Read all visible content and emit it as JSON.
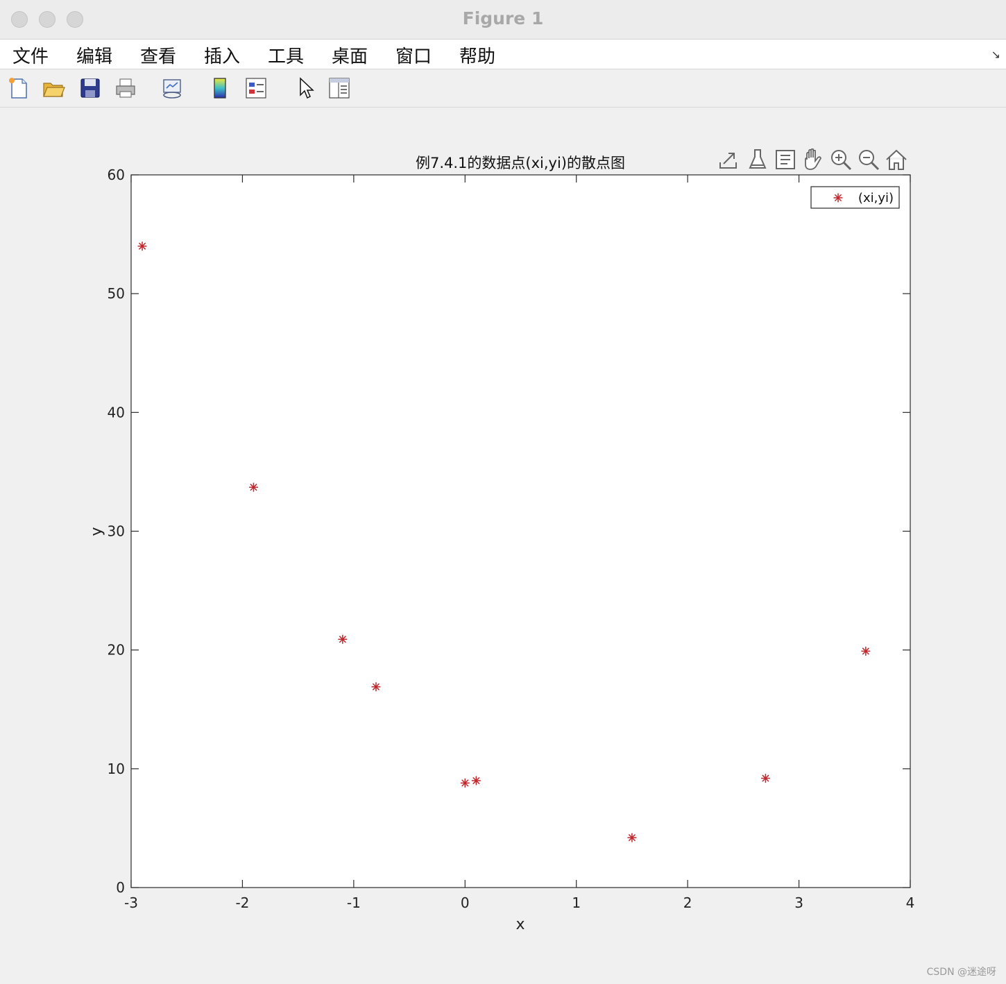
{
  "window": {
    "title": "Figure 1"
  },
  "menu": {
    "items": [
      "文件",
      "编辑",
      "查看",
      "插入",
      "工具",
      "桌面",
      "窗口",
      "帮助"
    ]
  },
  "toolbar": {
    "icons": [
      "new-figure-icon",
      "open-file-icon",
      "save-icon",
      "print-icon",
      "link-plot-icon",
      "colorbar-icon",
      "legend-icon",
      "edit-plot-pointer-icon",
      "property-inspector-icon"
    ]
  },
  "axes_toolbar": {
    "icons": [
      "export-icon",
      "brush-icon",
      "data-tips-icon",
      "pan-icon",
      "zoom-in-icon",
      "zoom-out-icon",
      "restore-view-icon"
    ]
  },
  "chart_data": {
    "type": "scatter",
    "title": "例7.4.1的数据点(xi,yi)的散点图",
    "xlabel": "x",
    "ylabel": "y",
    "xlim": [
      -3,
      4
    ],
    "ylim": [
      0,
      60
    ],
    "xticks": [
      "-3",
      "-2",
      "-1",
      "0",
      "1",
      "2",
      "3",
      "4"
    ],
    "yticks": [
      "0",
      "10",
      "20",
      "30",
      "40",
      "50",
      "60"
    ],
    "grid": false,
    "legend": {
      "position": "top-right",
      "entries": [
        "(xi,yi)"
      ]
    },
    "marker": "*",
    "color": "#c0262b",
    "series": [
      {
        "name": "(xi,yi)",
        "x": [
          -2.9,
          -1.9,
          -1.1,
          -0.8,
          0.0,
          0.1,
          1.5,
          2.7,
          3.6
        ],
        "y": [
          54.0,
          33.7,
          20.9,
          16.9,
          8.8,
          9.0,
          4.2,
          9.2,
          19.9
        ]
      }
    ]
  },
  "watermark": "CSDN @迷途呀"
}
